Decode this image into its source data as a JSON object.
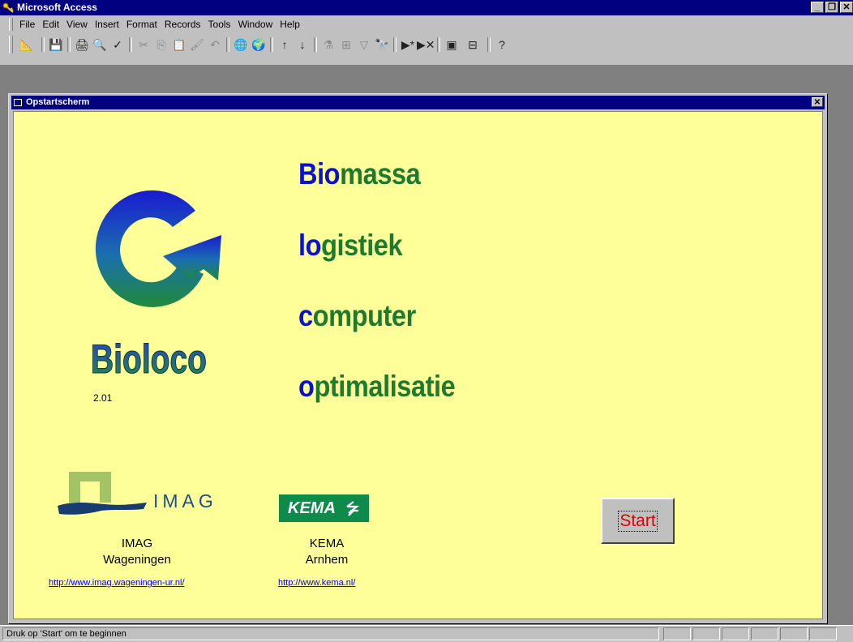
{
  "app": {
    "title": "Microsoft Access"
  },
  "menu": [
    "File",
    "Edit",
    "View",
    "Insert",
    "Format",
    "Records",
    "Tools",
    "Window",
    "Help"
  ],
  "toolbar": {
    "icons": [
      [
        "design-view-icon",
        "📐"
      ],
      [
        "save-icon",
        "💾"
      ],
      [
        "print-icon",
        "🖨"
      ],
      [
        "print-preview-icon",
        "🔍"
      ],
      [
        "spelling-icon",
        "✓"
      ],
      [
        "cut-icon",
        "✂"
      ],
      [
        "copy-icon",
        "⎘"
      ],
      [
        "paste-icon",
        "📋"
      ],
      [
        "format-painter-icon",
        "🖌"
      ],
      [
        "undo-icon",
        "↶"
      ],
      [
        "insert-hyperlink-icon",
        "🌐"
      ],
      [
        "web-toolbar-icon",
        "🌍"
      ],
      [
        "sort-ascending-icon",
        "↑"
      ],
      [
        "sort-descending-icon",
        "↓"
      ],
      [
        "filter-by-selection-icon",
        "⚗"
      ],
      [
        "filter-by-form-icon",
        "⊞"
      ],
      [
        "apply-filter-icon",
        "▽"
      ],
      [
        "find-icon",
        "🔭"
      ],
      [
        "new-record-icon",
        "▶*"
      ],
      [
        "delete-record-icon",
        "▶✕"
      ],
      [
        "database-window-icon",
        "▣"
      ],
      [
        "new-object-icon",
        "⊟"
      ],
      [
        "help-icon",
        "?"
      ]
    ]
  },
  "form": {
    "title": "Opstartscherm",
    "app_name": "Bioloco",
    "version": "2.01",
    "acronym_lines": [
      {
        "initial": "Bio",
        "rest": "massa"
      },
      {
        "initial": "lo",
        "rest": "gistiek"
      },
      {
        "initial": "c",
        "rest": "omputer"
      },
      {
        "initial": "o",
        "rest": "ptimalisatie"
      }
    ],
    "imag": {
      "logo_text": "IMAG",
      "name": "IMAG",
      "city": "Wageningen",
      "url": "http://www.imag.wageningen-ur.nl/"
    },
    "kema": {
      "logo_text": "KEMA",
      "name": "KEMA",
      "city": "Arnhem",
      "url": "http://www.kema.nl/"
    },
    "start_label": "Start"
  },
  "status": {
    "text": "Druk op 'Start' om te beginnen"
  },
  "colors": {
    "form_bg": "#ffff99",
    "title_bar": "#000080",
    "acronym_initial": "#0a12d0",
    "acronym_rest": "#1e7a2e",
    "start_text": "#e00000"
  }
}
